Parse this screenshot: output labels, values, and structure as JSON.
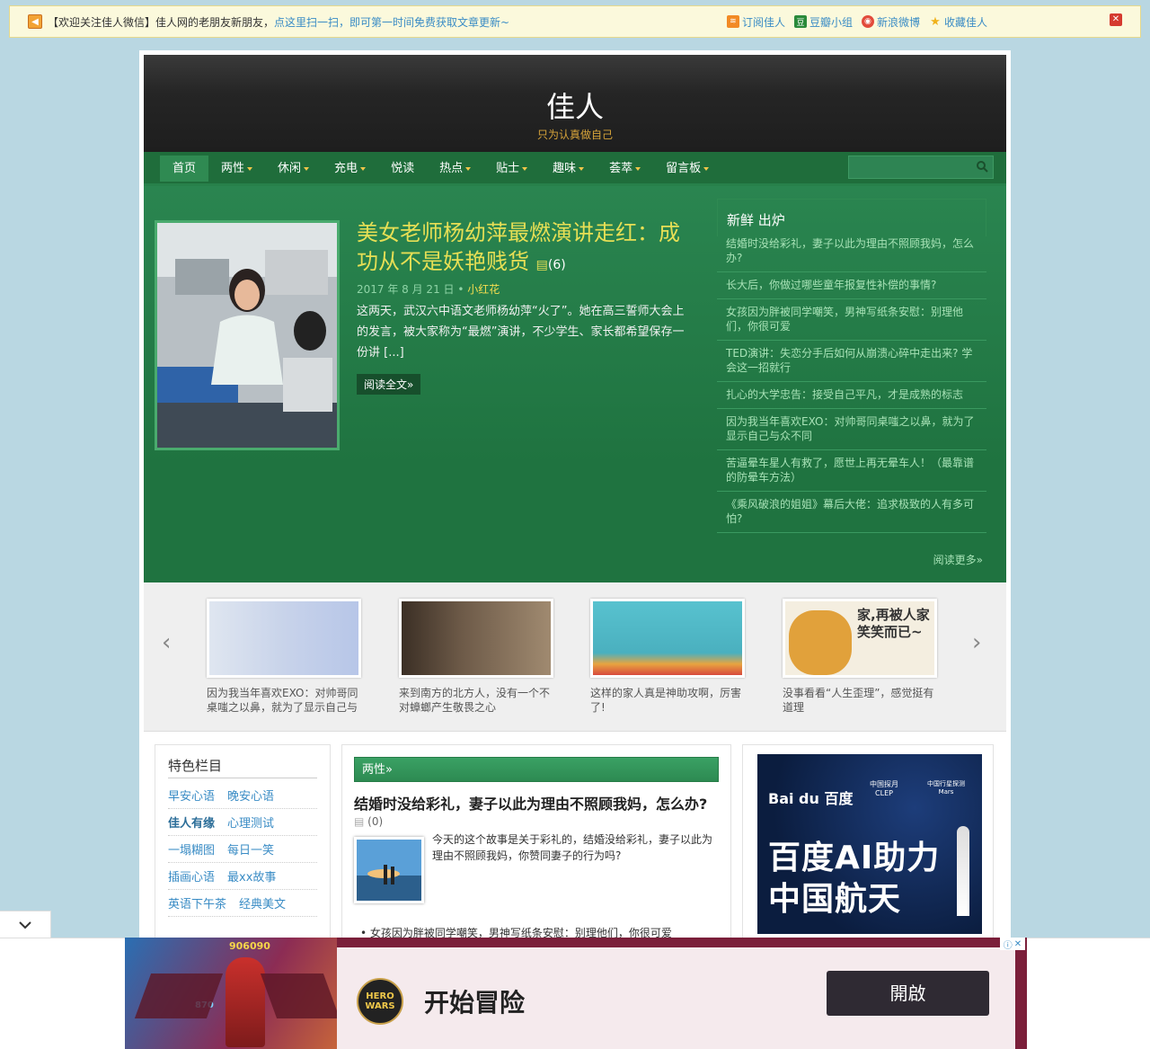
{
  "notice": {
    "text": "【欢迎关注佳人微信】佳人网的老朋友新朋友，",
    "link": "点这里扫一扫，即可第一时间免费获取文章更新~",
    "links": [
      "订阅佳人",
      "豆瓣小组",
      "新浪微博",
      "收藏佳人"
    ]
  },
  "site": {
    "title": "佳人",
    "tagline": "只为认真做自己"
  },
  "nav": {
    "items": [
      "首页",
      "两性",
      "休闲",
      "充电",
      "悦读",
      "热点",
      "贴士",
      "趣味",
      "荟萃",
      "留言板"
    ],
    "search_placeholder": ""
  },
  "featured": {
    "title": "美女老师杨幼萍最燃演讲走红：成功从不是妖艳贱货",
    "comments": "(6)",
    "date": "2017 年 8 月 21 日 • ",
    "author": "小红花",
    "excerpt": "这两天，武汉六中语文老师杨幼萍“火了”。她在高三誓师大会上的发言，被大家称为“最燃”演讲，不少学生、家长都希望保存一份讲 [...]",
    "more": "阅读全文»"
  },
  "fresh": {
    "title": "新鲜 出炉",
    "items": [
      "结婚时没给彩礼，妻子以此为理由不照顾我妈，怎么办?",
      "长大后，你做过哪些童年报复性补偿的事情?",
      "女孩因为胖被同学嘲笑，男神写纸条安慰：别理他们，你很可爱",
      "TED演讲：失恋分手后如何从崩溃心碎中走出来? 学会这一招就行",
      "扎心的大学忠告：接受自己平凡，才是成熟的标志",
      "因为我当年喜欢EXO：对帅哥同桌嗤之以鼻，就为了显示自己与众不同",
      "苦逼晕车星人有救了，愿世上再无晕车人！（最靠谱的防晕车方法）",
      "《乘风破浪的姐姐》幕后大佬：追求极致的人有多可怕?"
    ],
    "more": "阅读更多»"
  },
  "carousel": {
    "items": [
      "因为我当年喜欢EXO：对帅哥同桌嗤之以鼻，就为了显示自己与",
      "来到南方的北方人，没有一个不对蟑螂产生敬畏之心",
      "这样的家人真是神助攻啊，厉害了!",
      "没事看看“人生歪理”，感觉挺有道理"
    ],
    "thumb4_text": "家,再被人家笑笑而已~"
  },
  "special": {
    "title": "特色栏目",
    "rows": [
      [
        "早安心语",
        "晚安心语"
      ],
      [
        "佳人有缘",
        "心理测试"
      ],
      [
        "一塌糊图",
        "每日一笑"
      ],
      [
        "插画心语",
        "最xx故事"
      ],
      [
        "英语下午茶",
        "经典美文"
      ]
    ]
  },
  "category": {
    "label": "两性»",
    "post_title": "结婚时没给彩礼，妻子以此为理由不照顾我妈，怎么办?",
    "post_comments": "(0)",
    "excerpt": "今天的这个故事是关于彩礼的，结婚没给彩礼，妻子以此为理由不照顾我妈，你赞同妻子的行为吗?",
    "next": "女孩因为胖被同学嘲笑，男神写纸条安慰：别理他们，你很可爱"
  },
  "baidu_ad": {
    "logo": "Bai du 百度",
    "partner1": "中国探月 CLEP",
    "partner2": "中国行星探测 Mars",
    "line1": "百度AI助力",
    "line2": "中国航天"
  },
  "bottom_ad": {
    "score": "906090",
    "level": "870",
    "logo": "HERO WARS",
    "headline": "开始冒险",
    "button": "開啟"
  },
  "colors": {
    "nav_green": "#1f6d3b",
    "feature_green": "#2a8550",
    "title_yellow": "#e7df55",
    "link_blue": "#3a8cc5"
  }
}
